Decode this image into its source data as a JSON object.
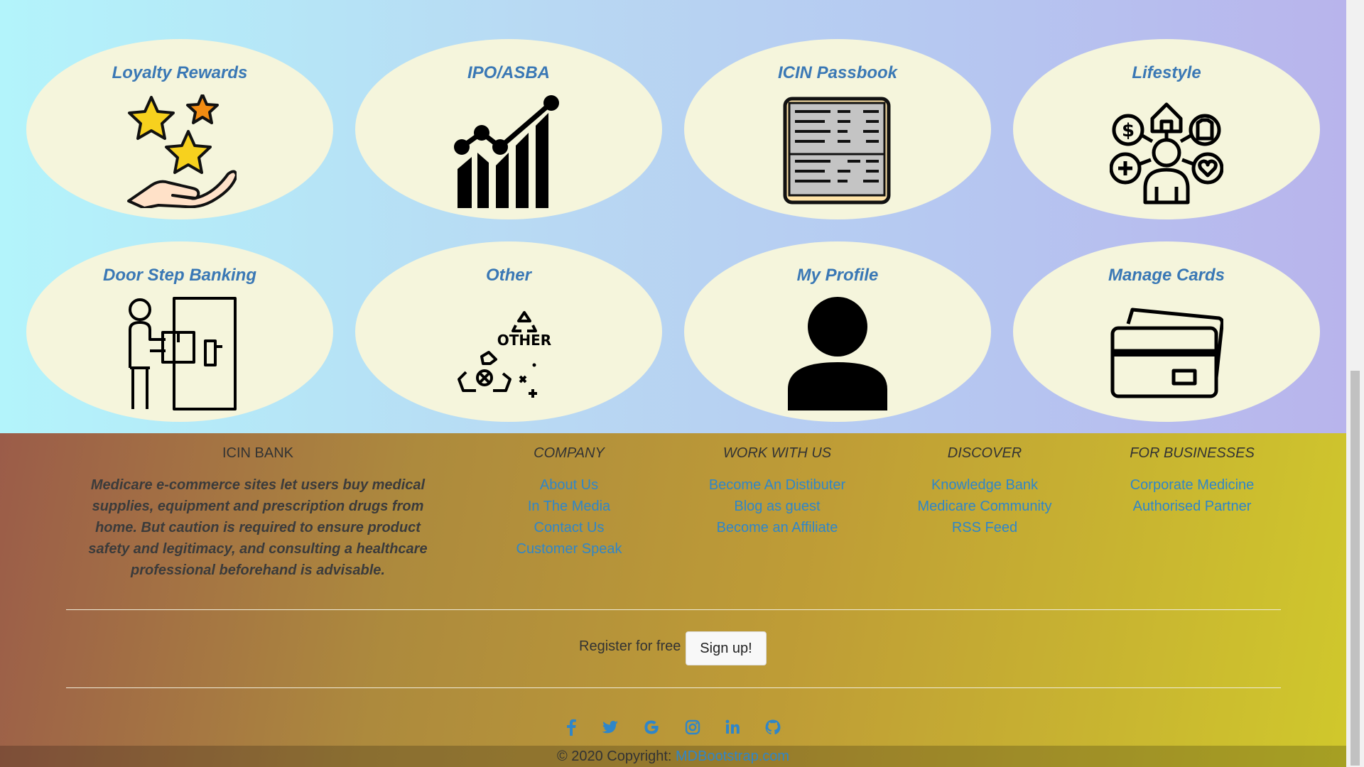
{
  "services": [
    {
      "title": "Loyalty Rewards",
      "icon": "loyalty-rewards-icon"
    },
    {
      "title": "IPO/ASBA",
      "icon": "ipo-chart-icon"
    },
    {
      "title": "ICIN Passbook",
      "icon": "passbook-icon"
    },
    {
      "title": "Lifestyle",
      "icon": "lifestyle-icon"
    },
    {
      "title": "Door Step Banking",
      "icon": "door-step-delivery-icon"
    },
    {
      "title": "Other",
      "icon": "other-recycle-icon"
    },
    {
      "title": "My Profile",
      "icon": "user-profile-icon"
    },
    {
      "title": "Manage Cards",
      "icon": "credit-cards-icon"
    }
  ],
  "footer": {
    "brand": {
      "heading": "ICIN BANK",
      "text": "Medicare e-commerce sites let users buy medical supplies, equipment and prescription drugs from home. But caution is required to ensure product safety and legitimacy, and consulting a healthcare professional beforehand is advisable."
    },
    "columns": [
      {
        "heading": "COMPANY",
        "links": [
          "About Us",
          "In The Media",
          "Contact Us",
          "Customer Speak"
        ]
      },
      {
        "heading": "WORK WITH US",
        "links": [
          "Become An Distibuter",
          "Blog as guest",
          "Become an Affiliate"
        ]
      },
      {
        "heading": "DISCOVER",
        "links": [
          "Knowledge Bank",
          "Medicare Community",
          "RSS Feed"
        ]
      },
      {
        "heading": "FOR BUSINESSES",
        "links": [
          "Corporate Medicine",
          "Authorised Partner"
        ]
      }
    ],
    "register_text": "Register for free",
    "signup_label": "Sign up!",
    "social": [
      "facebook-icon",
      "twitter-icon",
      "google-icon",
      "instagram-icon",
      "linkedin-icon",
      "github-icon"
    ],
    "copyright_prefix": "© 2020 Copyright:",
    "copyright_link": "MDBootstrap.com"
  },
  "colors": {
    "tile_bg": "#f5f5dc",
    "tile_title": "#3a78b5",
    "link": "#2f86c9"
  }
}
